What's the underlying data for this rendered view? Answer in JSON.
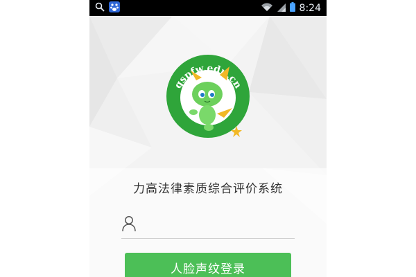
{
  "status_bar": {
    "time": "8:24",
    "icons": [
      "search-icon",
      "app-notification-icon",
      "wifi-icon",
      "signal-icon",
      "battery-icon"
    ]
  },
  "logo": {
    "text": "qspfw.edu.cn",
    "colors": {
      "ring": "#2fa53a",
      "mascot": "#6cd05c",
      "horn": "#f2b825"
    }
  },
  "app": {
    "title": "力高法律素质综合评价系统"
  },
  "login": {
    "username": {
      "value": "",
      "placeholder": "",
      "icon": "user-icon"
    },
    "submit_label": "人脸声纹登录",
    "button_color": "#4cbf57"
  }
}
